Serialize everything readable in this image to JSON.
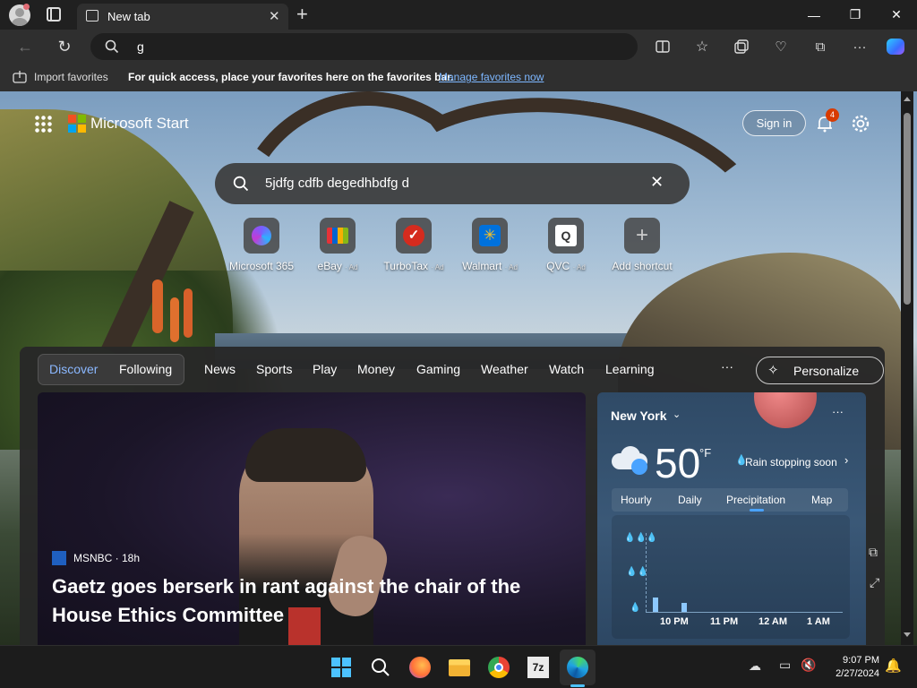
{
  "browser": {
    "tab_title": "New tab",
    "address_value": "g",
    "favorites_bar": {
      "import_label": "Import favorites",
      "hint": "For quick access, place your favorites here on the favorites bar.",
      "manage_link": "Manage favorites now"
    }
  },
  "start_page": {
    "brand": "Microsoft Start",
    "signin_label": "Sign in",
    "notification_count": "4",
    "search_value": "5jdfg cdfb degedhbdfg  d",
    "shortcuts": [
      {
        "label": "Microsoft 365",
        "ad": ""
      },
      {
        "label": "eBay",
        "ad": "· Ad"
      },
      {
        "label": "TurboTax",
        "ad": "· Ad"
      },
      {
        "label": "Walmart",
        "ad": "· Ad"
      },
      {
        "label": "QVC",
        "ad": "· Ad"
      },
      {
        "label": "Add shortcut",
        "ad": ""
      }
    ],
    "nav": {
      "tabs": [
        "Discover",
        "Following",
        "News",
        "Sports",
        "Play",
        "Money",
        "Gaming",
        "Weather",
        "Watch",
        "Learning"
      ],
      "more": "···",
      "personalize": "Personalize"
    },
    "hero": {
      "source": "MSNBC · 18h",
      "headline": "Gaetz goes berserk in rant against the chair of the House Ethics Committee"
    },
    "weather": {
      "city": "New York",
      "temp": "50",
      "unit": "°F",
      "condition": "Rain stopping soon",
      "tabs": [
        "Hourly",
        "Daily",
        "Precipitation",
        "Map"
      ],
      "times": [
        "10 PM",
        "11 PM",
        "12 AM",
        "1 AM"
      ],
      "menu": "···"
    }
  },
  "taskbar": {
    "time": "9:07 PM",
    "date": "2/27/2024",
    "sevenzip_label": "7z"
  }
}
